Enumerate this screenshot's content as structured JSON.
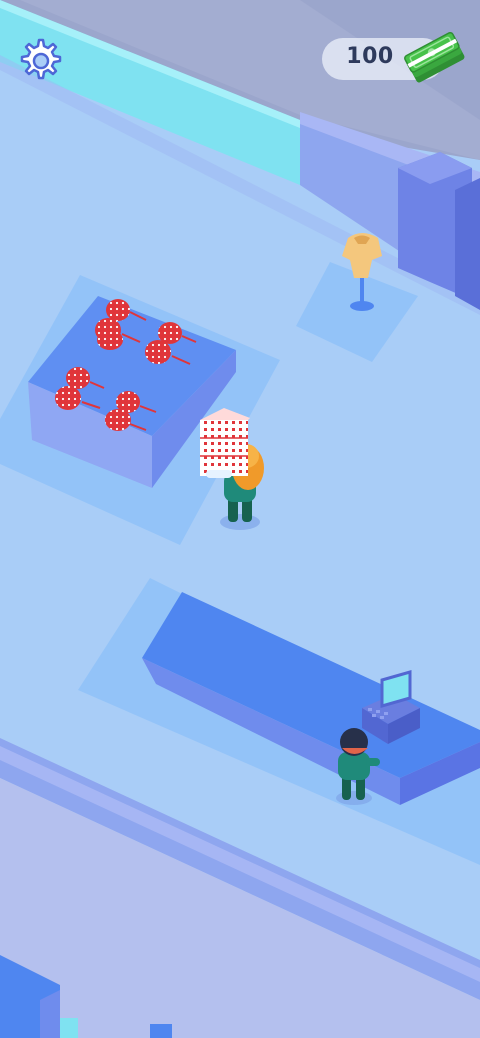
{
  "hud": {
    "money_amount": "100",
    "settings_icon": "gear-icon",
    "money_icon": "cash-stack-icon"
  },
  "colors": {
    "floor": "#a9cdf7",
    "wall": "#8ea6ef",
    "counter": "#4f86f0",
    "product_red": "#e0353a",
    "player_hair": "#f09a2a",
    "worker_uniform": "#1f8a7a",
    "cash_green": "#47c24a"
  },
  "scene": {
    "characters": [
      "player",
      "cashier"
    ],
    "objects": [
      "product-table",
      "mannequin",
      "checkout-counter",
      "cash-register",
      "carried-product-stack"
    ]
  }
}
